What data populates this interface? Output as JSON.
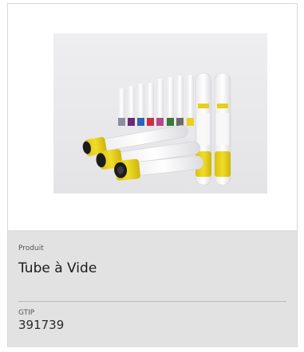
{
  "product": {
    "type_label": "Produit",
    "name": "Tube à Vide",
    "gtip_label": "GTIP",
    "gtip_value": "391739"
  },
  "photo": {
    "subject": "vacuum blood collection tubes with colored caps",
    "cap_colors": [
      "#8a8fa0",
      "#6a2a7a",
      "#2a67b8",
      "#c8323e",
      "#b24a8a",
      "#3a7a3c",
      "#6a6a6a",
      "#e8d21a"
    ],
    "accent_color": "#e6cf18"
  }
}
